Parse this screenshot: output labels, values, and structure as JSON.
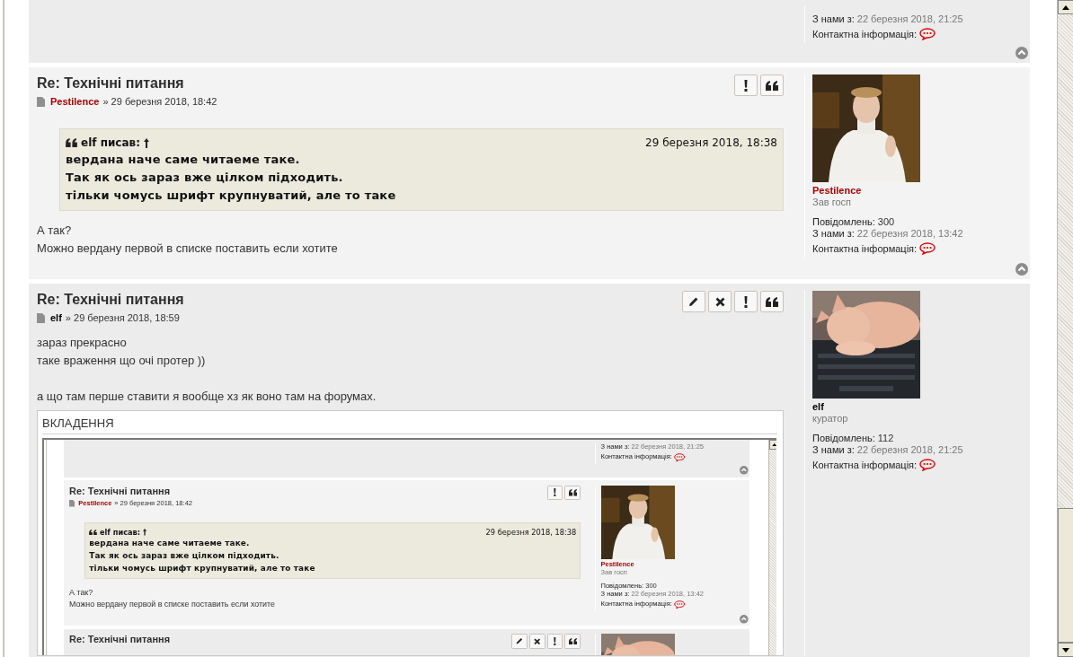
{
  "posts": [
    {
      "profile": {
        "joined_label": "З нами з:",
        "joined": "22 березня 2018, 21:25",
        "contact_label": "Контактна інформація:"
      },
      "back_to_top": true
    },
    {
      "title": "Re: Технічні питання",
      "author": {
        "name": "Pestilence",
        "color": "#aa0000"
      },
      "date": "» 29 березня 2018, 18:42",
      "buttons": [
        {
          "kind": "report"
        },
        {
          "kind": "quote"
        }
      ],
      "quote": {
        "author": "elf писав:",
        "date": "29 березня 2018, 18:38",
        "lines": [
          "вердана наче саме читаеме таке.",
          "Так як ось зараз вже цілком підходить.",
          "тільки чомусь шрифт крупнуватий, але то таке"
        ]
      },
      "body": [
        [
          "А так?",
          "Можно вердану первой в списке поставить если хотите"
        ]
      ],
      "profile": {
        "avatar": {
          "kind": "person"
        },
        "name": "Pestilence",
        "color": "#aa0000",
        "rank": "Зав госп",
        "posts_label": "Повідомлень:",
        "posts": "300",
        "joined_label": "З нами з:",
        "joined": "22 березня 2018, 13:42",
        "contact_label": "Контактна інформація:"
      },
      "back_to_top": true
    },
    {
      "title": "Re: Технічні питання",
      "author": {
        "name": "elf",
        "color": "#000000"
      },
      "date": "» 29 березня 2018, 18:59",
      "buttons": [
        {
          "kind": "edit"
        },
        {
          "kind": "delete"
        },
        {
          "kind": "report"
        },
        {
          "kind": "quote"
        }
      ],
      "body": [
        [
          "зараз прекрасно",
          "таке враження що очі протер ))"
        ],
        [
          "а що там перше ставити я вообще хз як воно там на форумах."
        ]
      ],
      "attachment": {
        "label": "ВКЛАДЕННЯ",
        "screenshot": {
          "posts": [
            {
              "profile": {
                "joined_label": "З нами з:",
                "joined": "22 березня 2018, 21:25",
                "contact_label": "Контактна інформація:"
              },
              "back_to_top": true
            },
            {
              "title": "Re: Технічні питання",
              "author": {
                "name": "Pestilence",
                "color": "#aa0000"
              },
              "date": "» 29 березня 2018, 18:42",
              "buttons": [
                {
                  "kind": "report"
                },
                {
                  "kind": "quote"
                }
              ],
              "quote": {
                "author": "elf писав:",
                "date": "29 березня 2018, 18:38",
                "lines": [
                  "вердана наче саме читаеме таке.",
                  "Так як ось зараз вже цілком підходить.",
                  "тільки чомусь шрифт крупнуватий, але то таке"
                ]
              },
              "body": [
                [
                  "А так?",
                  "Можно вердану первой в списке поставить если хотите"
                ]
              ],
              "profile": {
                "avatar": {
                  "kind": "person"
                },
                "name": "Pestilence",
                "color": "#aa0000",
                "rank": "Зав госп",
                "posts_label": "Повідомлень:",
                "posts": "300",
                "joined_label": "З нами з:",
                "joined": "22 березня 2018, 13:42",
                "contact_label": "Контактна інформація:"
              },
              "back_to_top": true
            },
            {
              "title": "Re: Технічні питання",
              "buttons": [
                {
                  "kind": "edit"
                },
                {
                  "kind": "delete"
                },
                {
                  "kind": "report"
                },
                {
                  "kind": "quote"
                }
              ],
              "profile": {
                "avatar": {
                  "kind": "cat"
                }
              }
            }
          ]
        }
      },
      "profile": {
        "avatar": {
          "kind": "cat"
        },
        "name": "elf",
        "color": "#000000",
        "rank": "куратор",
        "posts_label": "Повідомлень:",
        "posts": "112",
        "joined_label": "З нами з:",
        "joined": "22 березня 2018, 21:25",
        "contact_label": "Контактна інформація:"
      }
    }
  ]
}
